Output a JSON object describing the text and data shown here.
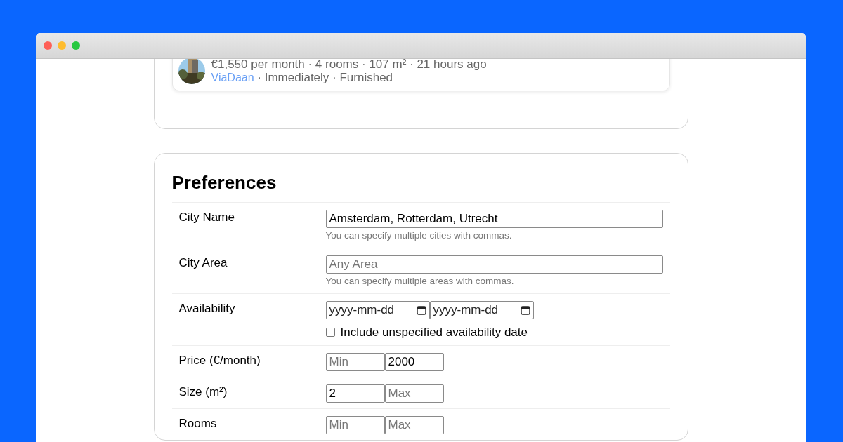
{
  "listing": {
    "summary": "€1,550 per month · 4 rooms · 107 m² · 21 hours ago",
    "agent": "ViaDaan",
    "details": " · Immediately · Furnished"
  },
  "preferences": {
    "title": "Preferences",
    "rows": [
      {
        "kind": "text",
        "label": "City Name",
        "fields": [
          {
            "value": "Amsterdam, Rotterdam, Utrecht"
          }
        ],
        "hint": "You can specify multiple cities with commas."
      },
      {
        "kind": "text",
        "label": "City Area",
        "fields": [
          {
            "placeholder": "Any Area"
          }
        ],
        "hint": "You can specify multiple areas with commas."
      },
      {
        "kind": "date",
        "label": "Availability",
        "fields": [
          {
            "placeholder": "yyyy-mm-dd"
          },
          {
            "placeholder": "yyyy-mm-dd"
          }
        ],
        "checkbox": {
          "label": "Include unspecified availability date",
          "checked": false
        }
      },
      {
        "kind": "range",
        "label": "Price (€/month)",
        "fields": [
          {
            "placeholder": "Min"
          },
          {
            "value": "2000"
          }
        ]
      },
      {
        "kind": "range",
        "label": "Size (m²)",
        "fields": [
          {
            "value": "2"
          },
          {
            "placeholder": "Max"
          }
        ]
      },
      {
        "kind": "range",
        "label": "Rooms",
        "fields": [
          {
            "placeholder": "Min"
          },
          {
            "placeholder": "Max"
          }
        ]
      }
    ]
  }
}
